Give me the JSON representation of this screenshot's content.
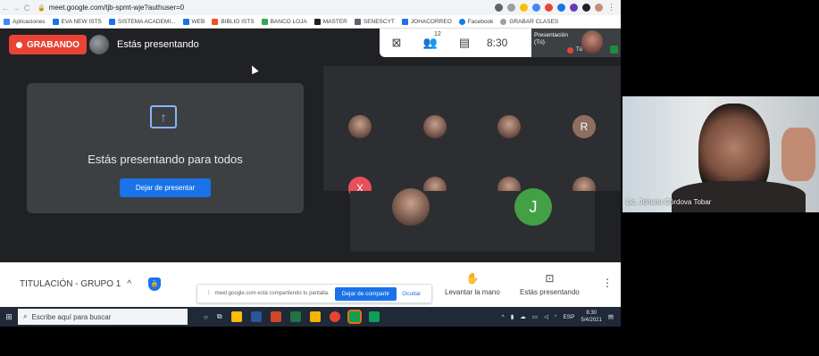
{
  "browser": {
    "url": "meet.google.com/tjb-spmt-wje?authuser=0",
    "bookmarks": [
      "Aplicaciones",
      "EVA NEW ISTS",
      "SISTEMA ACADEMI...",
      "WEB",
      "BIBLIO ISTS",
      "BANCO LOJA",
      "MASTER",
      "SENESCYT",
      "JOHACORREO",
      "Facebook",
      "GRABAR CLASES"
    ]
  },
  "meet": {
    "recording_label": "GRABANDO",
    "presenting_label": "Estás presentando",
    "participants_count": "12",
    "time": "8:30",
    "self_label_line1": "Presentación",
    "self_label_line2": "(Tú)",
    "self_tu": "Tú",
    "share_title": "Estás presentando para todos",
    "stop_presenting": "Dejar de presentar",
    "tiles": [
      {
        "initial": "",
        "type": "photo"
      },
      {
        "initial": "",
        "type": "photo"
      },
      {
        "initial": "",
        "type": "photo"
      },
      {
        "initial": "R",
        "type": "letter",
        "color": "#8d6e63"
      },
      {
        "initial": "X",
        "type": "letter",
        "color": "#e8505b"
      },
      {
        "initial": "",
        "type": "photo"
      },
      {
        "initial": "",
        "type": "photo"
      },
      {
        "initial": "",
        "type": "photo"
      },
      {
        "initial": "",
        "type": "photo"
      },
      {
        "initial": "J",
        "type": "letter",
        "color": "#43a047"
      }
    ]
  },
  "bottom_bar": {
    "meeting_name": "TITULACIÓN - GRUPO 1",
    "sharing_notice": "meet.google.com está compartiendo tu pantalla.",
    "notice_stop": "Dejar de compartir",
    "notice_hide": "Ocultar",
    "raise_hand": "Levantar la mano",
    "presenting": "Estás presentando"
  },
  "taskbar": {
    "search_placeholder": "Escribe aquí para buscar",
    "lang": "ESP",
    "time": "8:30",
    "date": "5/4/2021"
  },
  "webcam": {
    "name": "Lic. Johana Córdova Tobar"
  }
}
